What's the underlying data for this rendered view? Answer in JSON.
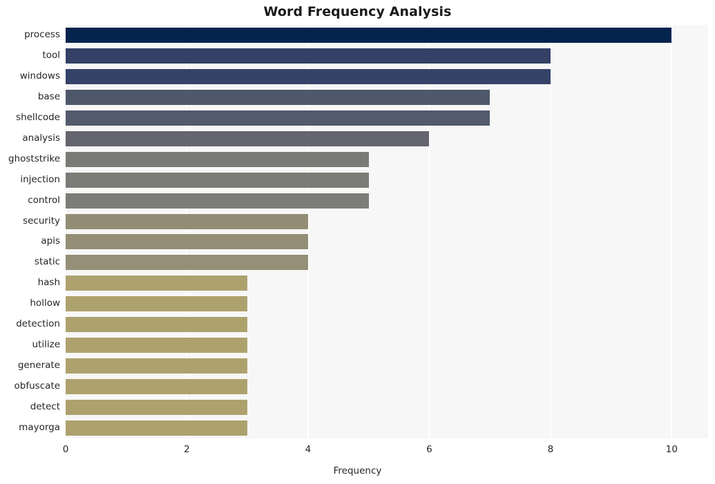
{
  "chart_data": {
    "type": "bar",
    "orientation": "horizontal",
    "title": "Word Frequency Analysis",
    "xlabel": "Frequency",
    "ylabel": "",
    "categories": [
      "process",
      "tool",
      "windows",
      "base",
      "shellcode",
      "analysis",
      "ghoststrike",
      "injection",
      "control",
      "security",
      "apis",
      "static",
      "hash",
      "hollow",
      "detection",
      "utilize",
      "generate",
      "obfuscate",
      "detect",
      "mayorga"
    ],
    "values": [
      10,
      8,
      8,
      7,
      7,
      6,
      5,
      5,
      5,
      4,
      4,
      4,
      3,
      3,
      3,
      3,
      3,
      3,
      3,
      3
    ],
    "xticks": [
      0,
      2,
      4,
      6,
      8,
      10
    ],
    "xtick_labels": [
      "0",
      "2",
      "4",
      "6",
      "8",
      "10"
    ],
    "xlim": [
      0,
      10.6
    ],
    "grid": true,
    "grid_axis": "x",
    "legend": false,
    "bar_colors": [
      "#04234d",
      "#344065",
      "#364369",
      "#4f576b",
      "#525a6c",
      "#64656e",
      "#7a7a76",
      "#7b7b77",
      "#7c7c78",
      "#938d75",
      "#948e76",
      "#958f77",
      "#ada26e",
      "#ada26e",
      "#ada26e",
      "#ada26e",
      "#ada26e",
      "#ada26e",
      "#ada26e",
      "#ada26e"
    ],
    "plot_background": "#f7f7f7",
    "grid_color": "#ffffff",
    "figure_background": "#ffffff",
    "text_color": "#262626"
  }
}
